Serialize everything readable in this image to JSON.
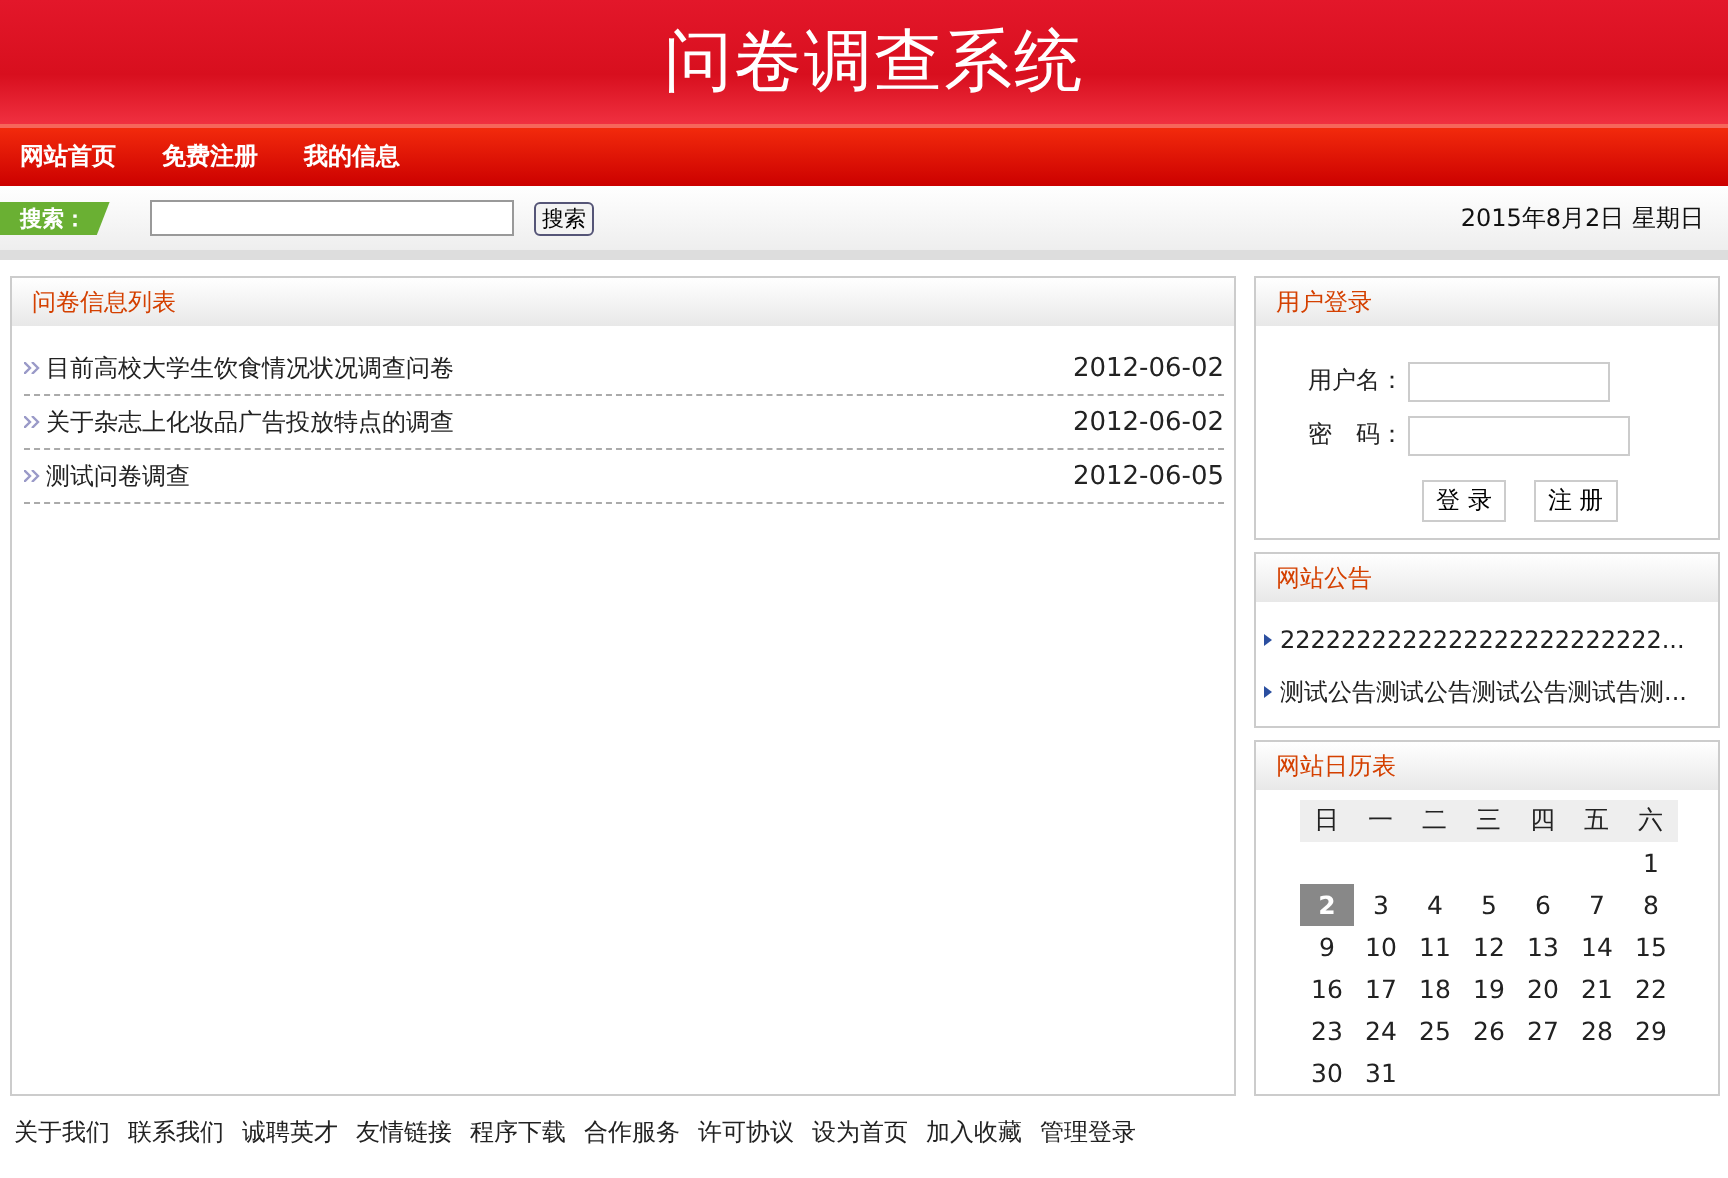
{
  "header": {
    "title": "问卷调查系统"
  },
  "nav": [
    {
      "label": "网站首页"
    },
    {
      "label": "免费注册"
    },
    {
      "label": "我的信息"
    }
  ],
  "search": {
    "label": "搜索：",
    "button": "搜索",
    "date": "2015年8月2日 星期日"
  },
  "survey_list": {
    "title": "问卷信息列表",
    "items": [
      {
        "title": "目前高校大学生饮食情况状况调查问卷",
        "date": "2012-06-02"
      },
      {
        "title": "关于杂志上化妆品广告投放特点的调查",
        "date": "2012-06-02"
      },
      {
        "title": "测试问卷调查",
        "date": "2012-06-05"
      }
    ]
  },
  "login": {
    "title": "用户登录",
    "username_label": "用户名：",
    "password_label": "密　码：",
    "login_button": "登 录",
    "register_button": "注 册"
  },
  "notices": {
    "title": "网站公告",
    "items": [
      "2222222222222222222222222...",
      "测试公告测试公告测试公告测试告测..."
    ]
  },
  "calendar": {
    "title": "网站日历表",
    "weekdays": [
      "日",
      "一",
      "二",
      "三",
      "四",
      "五",
      "六"
    ],
    "weeks": [
      [
        {
          "kind": "blank"
        },
        {
          "kind": "blank"
        },
        {
          "kind": "blank"
        },
        {
          "kind": "blank"
        },
        {
          "kind": "blank"
        },
        {
          "kind": "blank"
        },
        {
          "kind": "day",
          "day": "1",
          "selected": false
        }
      ],
      [
        {
          "day": "2",
          "selected": true
        },
        {
          "day": "3",
          "selected": false
        },
        {
          "day": "4",
          "selected": false
        },
        {
          "day": "5",
          "selected": false
        },
        {
          "day": "6",
          "selected": false
        },
        {
          "day": "7",
          "selected": false
        },
        {
          "day": "8",
          "selected": false
        }
      ],
      [
        {
          "day": "9",
          "selected": false
        },
        {
          "day": "10",
          "selected": false
        },
        {
          "day": "11",
          "selected": false
        },
        {
          "day": "12",
          "selected": false
        },
        {
          "day": "13",
          "selected": false
        },
        {
          "day": "14",
          "selected": false
        },
        {
          "day": "15",
          "selected": false
        }
      ],
      [
        {
          "day": "16",
          "selected": false
        },
        {
          "day": "17",
          "selected": false
        },
        {
          "day": "18",
          "selected": false
        },
        {
          "day": "19",
          "selected": false
        },
        {
          "day": "20",
          "selected": false
        },
        {
          "day": "21",
          "selected": false
        },
        {
          "day": "22",
          "selected": false
        }
      ],
      [
        {
          "day": "23",
          "selected": false
        },
        {
          "day": "24",
          "selected": false
        },
        {
          "day": "25",
          "selected": false
        },
        {
          "day": "26",
          "selected": false
        },
        {
          "day": "27",
          "selected": false
        },
        {
          "day": "28",
          "selected": false
        },
        {
          "day": "29",
          "selected": false
        }
      ],
      [
        {
          "day": "30",
          "selected": false
        },
        {
          "day": "31",
          "selected": false
        }
      ]
    ]
  },
  "footer": {
    "links": [
      "关于我们",
      "联系我们",
      "诚聘英才",
      "友情链接",
      "程序下载",
      "合作服务",
      "许可协议",
      "设为首页",
      "加入收藏",
      "管理登录"
    ]
  }
}
